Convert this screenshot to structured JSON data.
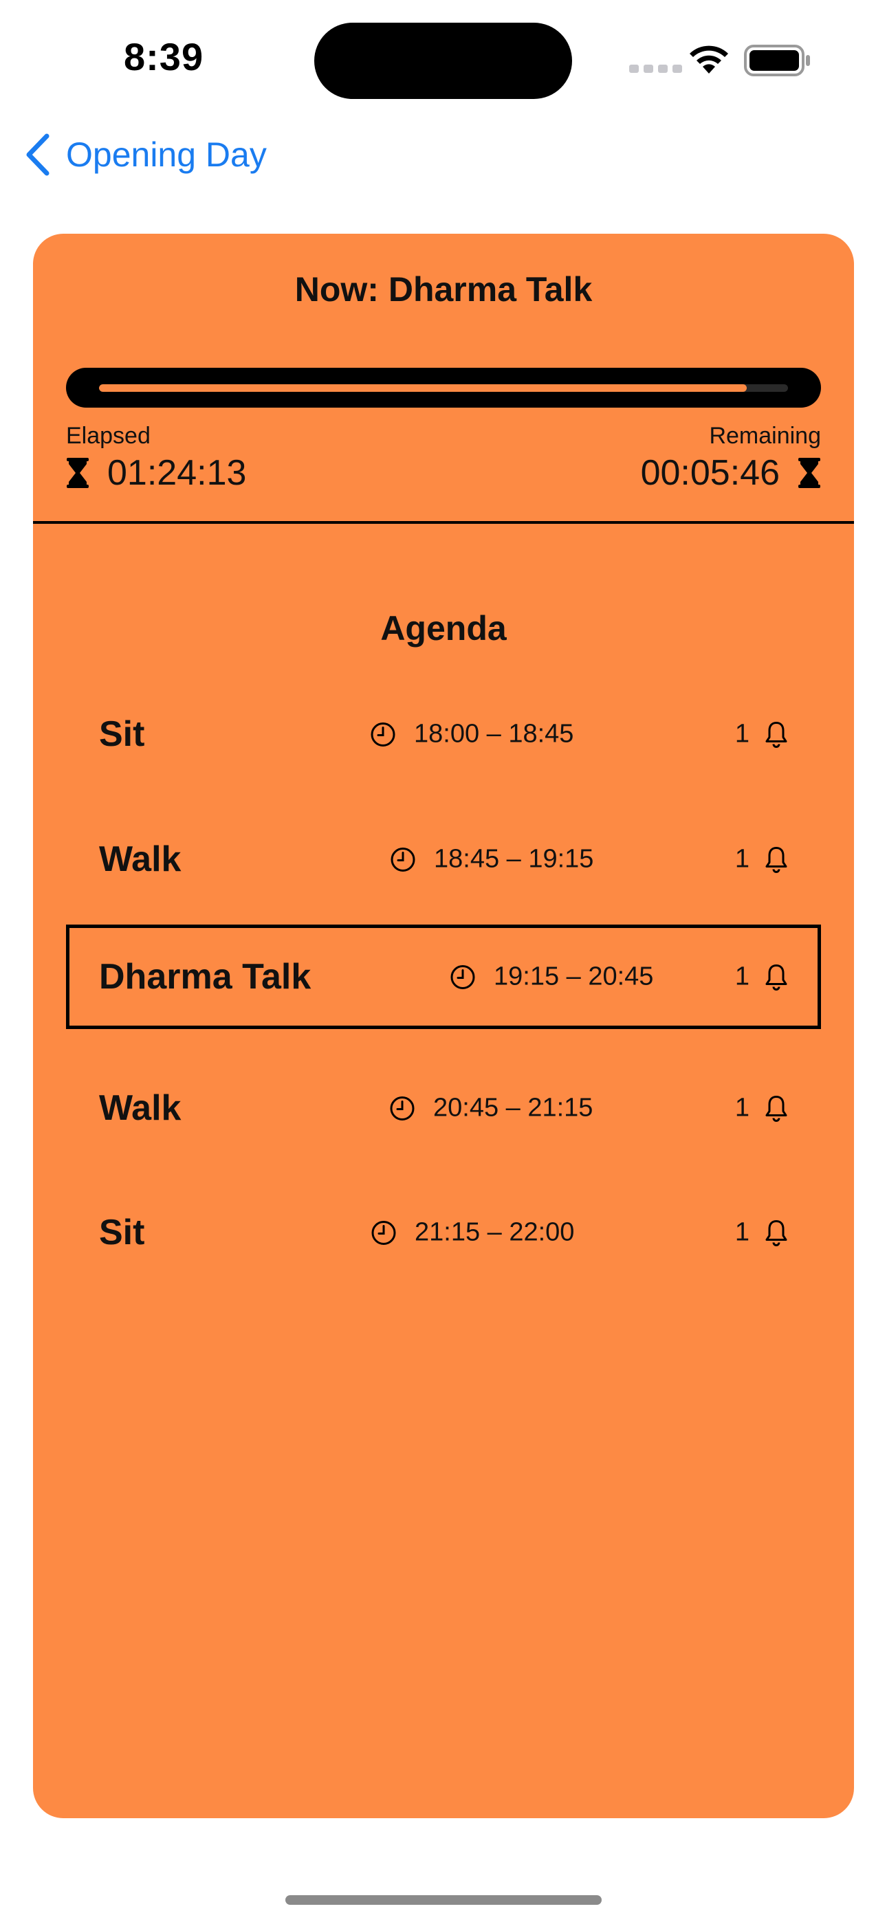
{
  "status_bar": {
    "time": "8:39"
  },
  "nav": {
    "back_label": "Opening Day"
  },
  "now": {
    "title": "Now: Dharma Talk",
    "progress_fraction": 0.94,
    "elapsed_label": "Elapsed",
    "elapsed_value": "01:24:13",
    "remaining_label": "Remaining",
    "remaining_value": "00:05:46"
  },
  "agenda": {
    "title": "Agenda",
    "items": [
      {
        "name": "Sit",
        "time": "18:00 – 18:45",
        "bells": "1",
        "current": false
      },
      {
        "name": "Walk",
        "time": "18:45 – 19:15",
        "bells": "1",
        "current": false
      },
      {
        "name": "Dharma Talk",
        "time": "19:15 – 20:45",
        "bells": "1",
        "current": true
      },
      {
        "name": "Walk",
        "time": "20:45 – 21:15",
        "bells": "1",
        "current": false
      },
      {
        "name": "Sit",
        "time": "21:15 – 22:00",
        "bells": "1",
        "current": false
      }
    ]
  },
  "colors": {
    "card_background": "#fd8a44",
    "accent_blue": "#1a7cf0",
    "text": "#111111"
  },
  "icons": [
    "chevron-left-icon",
    "hourglass-icon",
    "clock-icon",
    "bell-icon",
    "wifi-icon",
    "battery-icon"
  ]
}
